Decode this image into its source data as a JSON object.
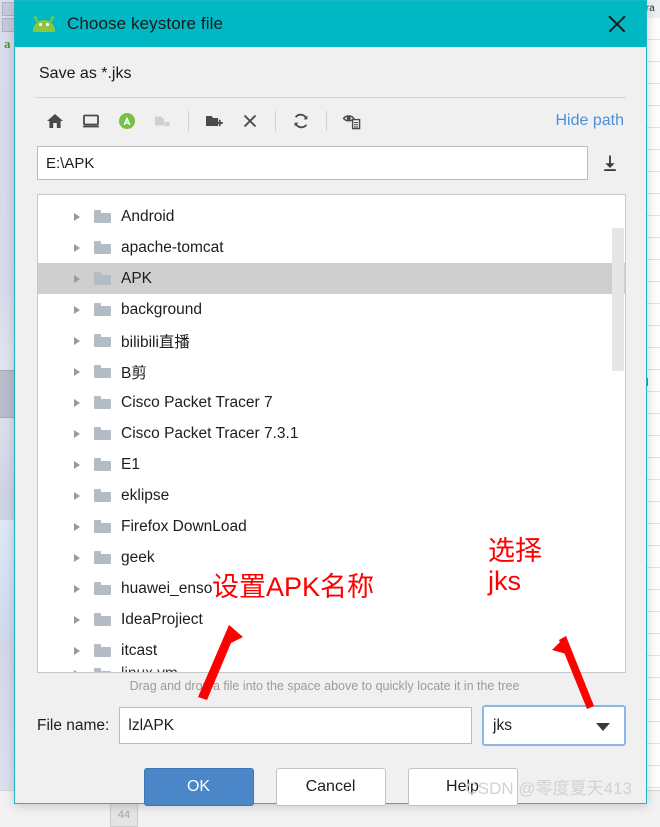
{
  "window": {
    "title": "Choose keystore file",
    "close_icon": "close-icon",
    "app_icon": "android-robot-icon"
  },
  "dialog": {
    "save_as_label": "Save as *.jks",
    "hide_path_label": "Hide path",
    "path_value": "E:\\APK",
    "download_icon": "download-icon",
    "hint": "Drag and drop a file into the space above to quickly locate it in the tree",
    "filename_label": "File name:",
    "filename_value": "lzlAPK",
    "extension_value": "jks"
  },
  "toolbar": {
    "items": [
      {
        "name": "home-icon",
        "label": "Home",
        "disabled": false
      },
      {
        "name": "desktop-icon",
        "label": "Desktop",
        "disabled": false
      },
      {
        "name": "android-project-icon",
        "label": "Project",
        "disabled": false
      },
      {
        "name": "folder-icon",
        "label": "Module directory",
        "disabled": true
      },
      {
        "name": "new-folder-icon",
        "label": "New Folder",
        "disabled": false
      },
      {
        "name": "delete-icon",
        "label": "Delete",
        "disabled": false
      },
      {
        "name": "refresh-icon",
        "label": "Refresh",
        "disabled": false
      },
      {
        "name": "show-hidden-files-icon",
        "label": "Show Hidden Files",
        "disabled": false
      }
    ]
  },
  "tree": {
    "selected": "APK",
    "items": [
      {
        "label": "Android",
        "selected": false
      },
      {
        "label": "apache-tomcat",
        "selected": false
      },
      {
        "label": "APK",
        "selected": true
      },
      {
        "label": "background",
        "selected": false
      },
      {
        "label": "bilibili直播",
        "selected": false
      },
      {
        "label": "B剪",
        "selected": false
      },
      {
        "label": "Cisco Packet Tracer 7",
        "selected": false
      },
      {
        "label": "Cisco Packet Tracer 7.3.1",
        "selected": false
      },
      {
        "label": "E1",
        "selected": false
      },
      {
        "label": "eklipse",
        "selected": false
      },
      {
        "label": "Firefox DownLoad",
        "selected": false
      },
      {
        "label": "geek",
        "selected": false
      },
      {
        "label": "huawei_enso",
        "selected": false
      },
      {
        "label": "IdeaProjiect",
        "selected": false
      },
      {
        "label": "itcast",
        "selected": false
      },
      {
        "label": "linux vm",
        "selected": false
      }
    ]
  },
  "buttons": {
    "ok": "OK",
    "cancel": "Cancel",
    "help": "Help"
  },
  "annotations": [
    {
      "name": "annotation-set-apk-name",
      "text": "设置APK名称"
    },
    {
      "name": "annotation-select-jks",
      "text": "选择\njks"
    }
  ],
  "watermark": "CSDN @零度夏天413",
  "background": {
    "right_panel_header": "Gra",
    "bottom_badge": "44",
    "left_marker": "a"
  },
  "colors": {
    "titlebar": "#00b8c4",
    "accent_button": "#4a86c8",
    "link": "#4a90d9",
    "annotation": "#ff0000",
    "selection": "#cfcfcf",
    "dialog_bg": "#f0f0f0"
  }
}
